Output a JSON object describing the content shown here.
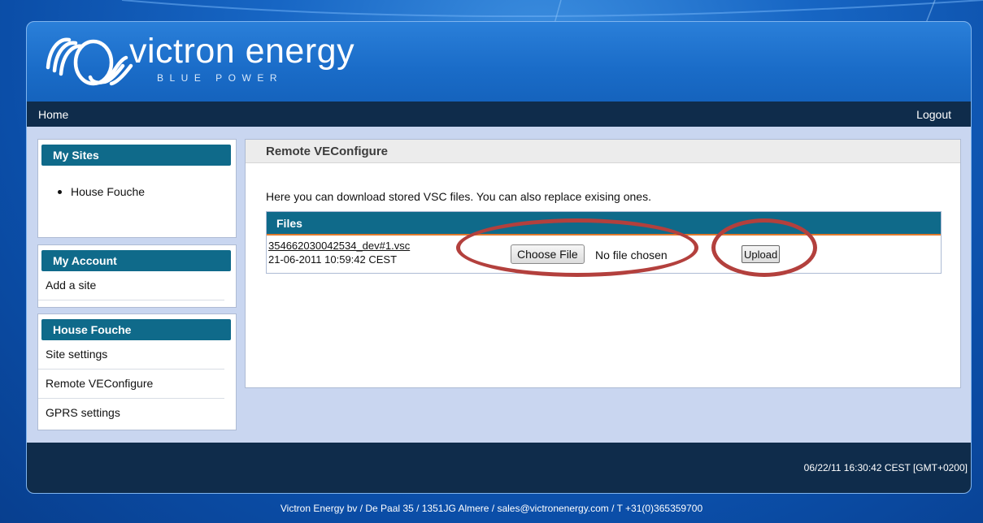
{
  "brand": {
    "name": "victron energy",
    "tagline": "BLUE POWER"
  },
  "nav": {
    "home": "Home",
    "logout": "Logout"
  },
  "sidebar": {
    "my_sites": {
      "title": "My Sites",
      "items": [
        "House Fouche"
      ]
    },
    "my_account": {
      "title": "My Account",
      "links": [
        "Add a site"
      ]
    },
    "site": {
      "title": "House Fouche",
      "links": [
        "Site settings",
        "Remote VEConfigure",
        "GPRS settings"
      ]
    }
  },
  "main": {
    "title": "Remote VEConfigure",
    "intro": "Here you can download stored VSC files. You can also replace exising ones.",
    "files_header": "Files",
    "file": {
      "name": "354662030042534_dev#1.vsc",
      "date": "21-06-2011 10:59:42 CEST"
    },
    "choose_file_label": "Choose File",
    "no_file_text": "No file chosen",
    "upload_label": "Upload"
  },
  "footer": {
    "clock": "06/22/11 16:30:42 CEST [GMT+0200]",
    "address": "Victron Energy bv / De Paal 35 / 1351JG Almere / sales@victronenergy.com / T +31(0)365359700"
  },
  "colors": {
    "accent": "#0f6a8a",
    "nav_bg": "#0f2c4b",
    "annotation": "#b3403d"
  }
}
